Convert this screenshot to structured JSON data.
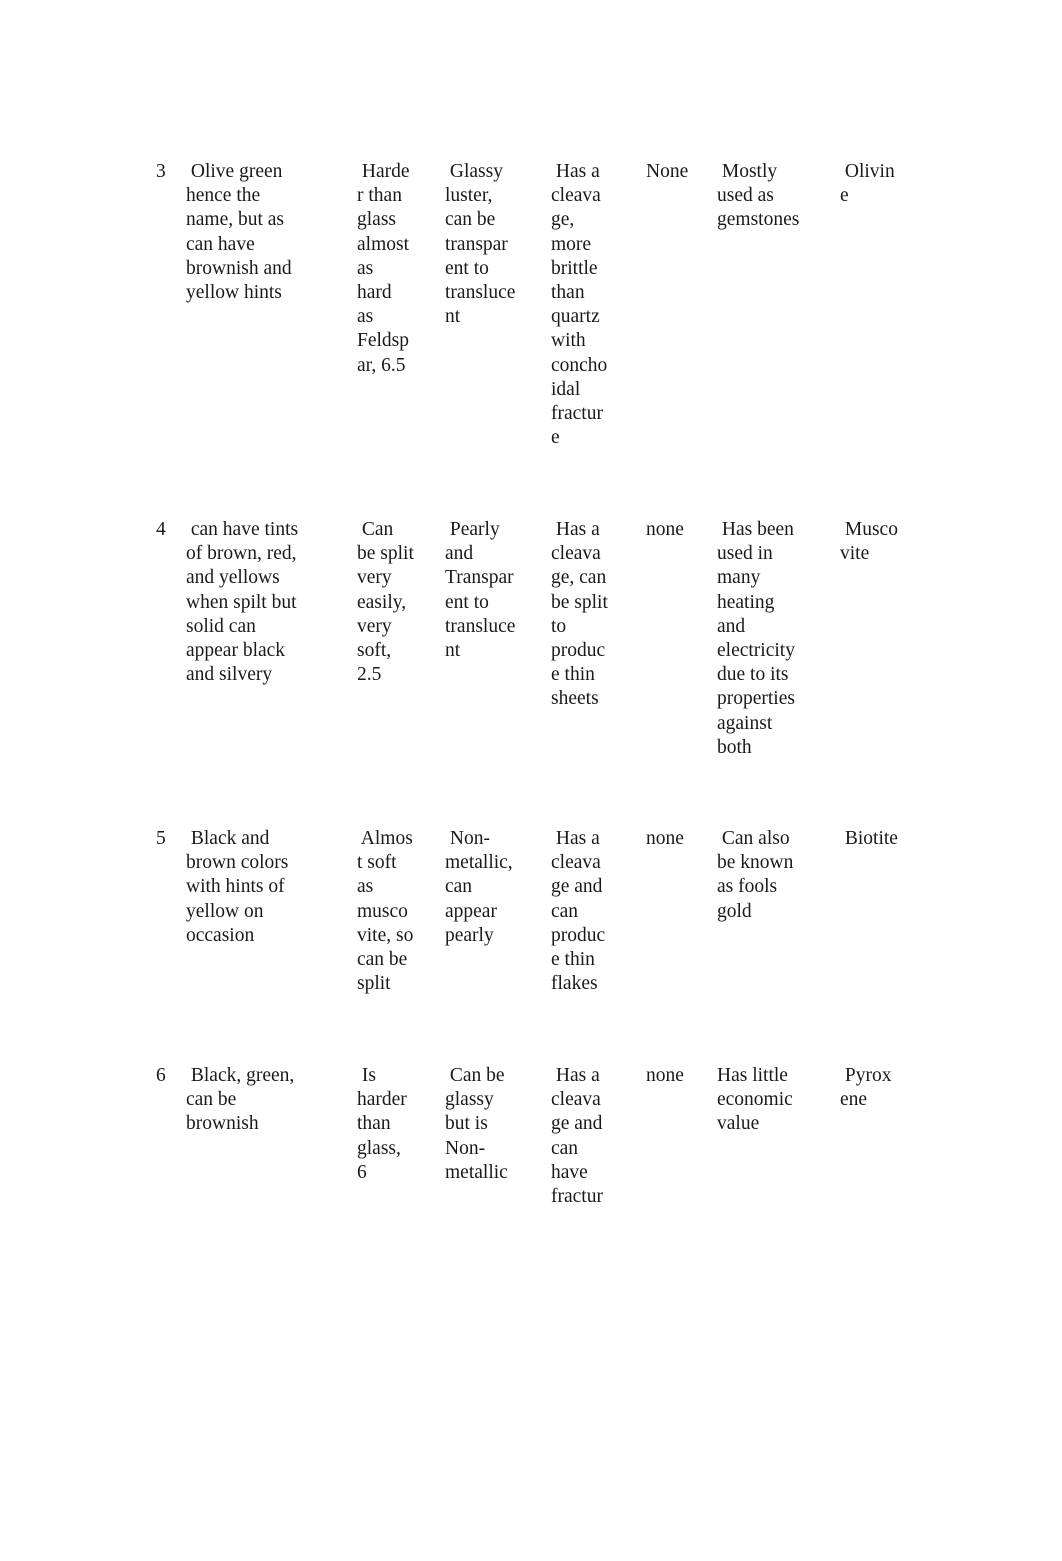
{
  "document": {
    "rows": [
      {
        "number": "3",
        "color": [
          " Olive green",
          "hence the",
          "name, but as",
          "can have",
          "brownish and",
          "yellow hints"
        ],
        "hardness": [
          " Harde",
          "r than",
          "glass",
          "almost",
          "as",
          "hard",
          "as",
          "Feldsp",
          "ar, 6.5"
        ],
        "luster": [
          " Glassy",
          "luster,",
          "can be",
          "transpar",
          "ent to",
          "transluce",
          "nt"
        ],
        "cleavage": [
          " Has a",
          "cleava",
          "ge,",
          "more",
          "brittle",
          "than",
          "quartz",
          "with",
          "concho",
          "idal",
          "fractur",
          "e"
        ],
        "streak": [
          "None"
        ],
        "uses": [
          " Mostly",
          "used as",
          "gemstones"
        ],
        "mineral": [
          " Olivin",
          "e"
        ]
      },
      {
        "number": "4",
        "color": [
          " can have tints",
          "of brown, red,",
          "and yellows",
          "when spilt but",
          "solid can",
          "appear black",
          "and silvery"
        ],
        "hardness": [
          " Can",
          "be split",
          "very",
          "easily,",
          "very",
          "soft,",
          "2.5"
        ],
        "luster": [
          " Pearly",
          "and",
          "Transpar",
          "ent to",
          "transluce",
          "nt"
        ],
        "cleavage": [
          " Has a",
          "cleava",
          "ge, can",
          "be split",
          "to",
          "produc",
          "e thin",
          "sheets"
        ],
        "streak": [
          "none"
        ],
        "uses": [
          " Has been",
          "used in",
          "many",
          "heating",
          "and",
          "electricity",
          "due to its",
          "properties",
          "against",
          "both"
        ],
        "mineral": [
          " Musco",
          "vite"
        ]
      },
      {
        "number": "5",
        "color": [
          " Black and",
          "brown colors",
          "with hints of",
          "yellow on",
          "occasion"
        ],
        "hardness": [
          " Almos",
          "t soft",
          "as",
          "musco",
          "vite, so",
          "can be",
          "split"
        ],
        "luster": [
          " Non-",
          "metallic,",
          "can",
          "appear",
          "pearly"
        ],
        "cleavage": [
          " Has a",
          "cleava",
          "ge and",
          "can",
          "produc",
          "e thin",
          "flakes"
        ],
        "streak": [
          "none"
        ],
        "uses": [
          " Can also",
          "be known",
          "as fools",
          "gold"
        ],
        "mineral": [
          " Biotite"
        ]
      },
      {
        "number": "6",
        "color": [
          " Black, green,",
          "can be",
          "brownish"
        ],
        "hardness": [
          " Is",
          "harder",
          "than",
          "glass,",
          "6"
        ],
        "luster": [
          " Can be",
          "glassy",
          "but is",
          "Non-",
          "metallic"
        ],
        "cleavage": [
          " Has a",
          "cleava",
          "ge and",
          "can",
          "have",
          "fractur"
        ],
        "streak": [
          "none"
        ],
        "uses": [
          "Has little",
          "economic",
          "value"
        ],
        "mineral": [
          " Pyrox",
          "ene"
        ]
      }
    ]
  }
}
